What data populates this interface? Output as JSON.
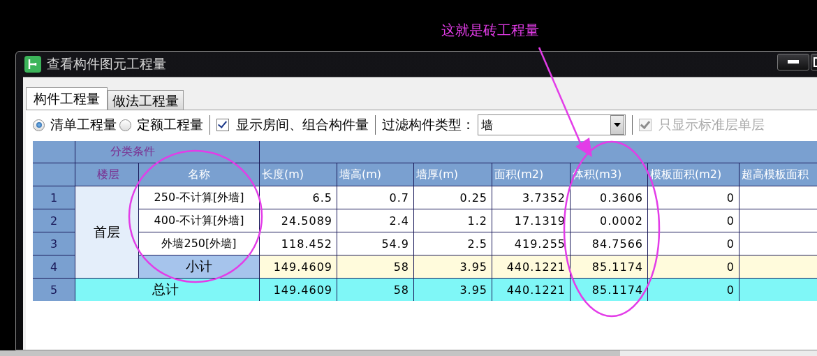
{
  "annotation": {
    "text": "这就是砖工程量"
  },
  "window": {
    "title": "查看构件图元工程量"
  },
  "tabs": [
    {
      "label": "构件工程量",
      "selected": true
    },
    {
      "label": "做法工程量",
      "selected": false
    }
  ],
  "toolbar": {
    "radios": [
      {
        "label": "清单工程量",
        "selected": true
      },
      {
        "label": "定额工程量",
        "selected": false
      }
    ],
    "show_rooms": {
      "label": "显示房间、组合构件量",
      "checked": true
    },
    "filter": {
      "label": "过滤构件类型：",
      "value": "墙"
    },
    "standard_only": {
      "label": "只显示标准层单层",
      "checked": true,
      "disabled": true
    }
  },
  "table": {
    "group_header": "分类条件",
    "columns": [
      "楼层",
      "名称",
      "长度(m)",
      "墙高(m)",
      "墙厚(m)",
      "面积(m2)",
      "体积(m3)",
      "模板面积(m2)",
      "超高模板面积"
    ],
    "groups": [
      {
        "floor": "首层",
        "rows": [
          {
            "kind": "item",
            "number": "1",
            "name": "250-不计算[外墙]",
            "values": [
              "6.5",
              "0.7",
              "0.25",
              "3.7352",
              "0.3606",
              "0"
            ]
          },
          {
            "kind": "item",
            "number": "2",
            "name": "400-不计算[外墙]",
            "values": [
              "24.5089",
              "2.4",
              "1.2",
              "17.1319",
              "0.0002",
              "0"
            ]
          },
          {
            "kind": "item",
            "number": "3",
            "name": "外墙250[外墙]",
            "values": [
              "118.452",
              "54.9",
              "2.5",
              "419.255",
              "84.7566",
              "0"
            ]
          },
          {
            "kind": "subtotal",
            "number": "4",
            "name": "小计",
            "values": [
              "149.4609",
              "58",
              "3.95",
              "440.1221",
              "85.1174",
              "0"
            ]
          }
        ]
      }
    ],
    "total": {
      "number": "5",
      "name": "总计",
      "values": [
        "149.4609",
        "58",
        "3.95",
        "440.1221",
        "85.1174",
        "0"
      ]
    }
  }
}
